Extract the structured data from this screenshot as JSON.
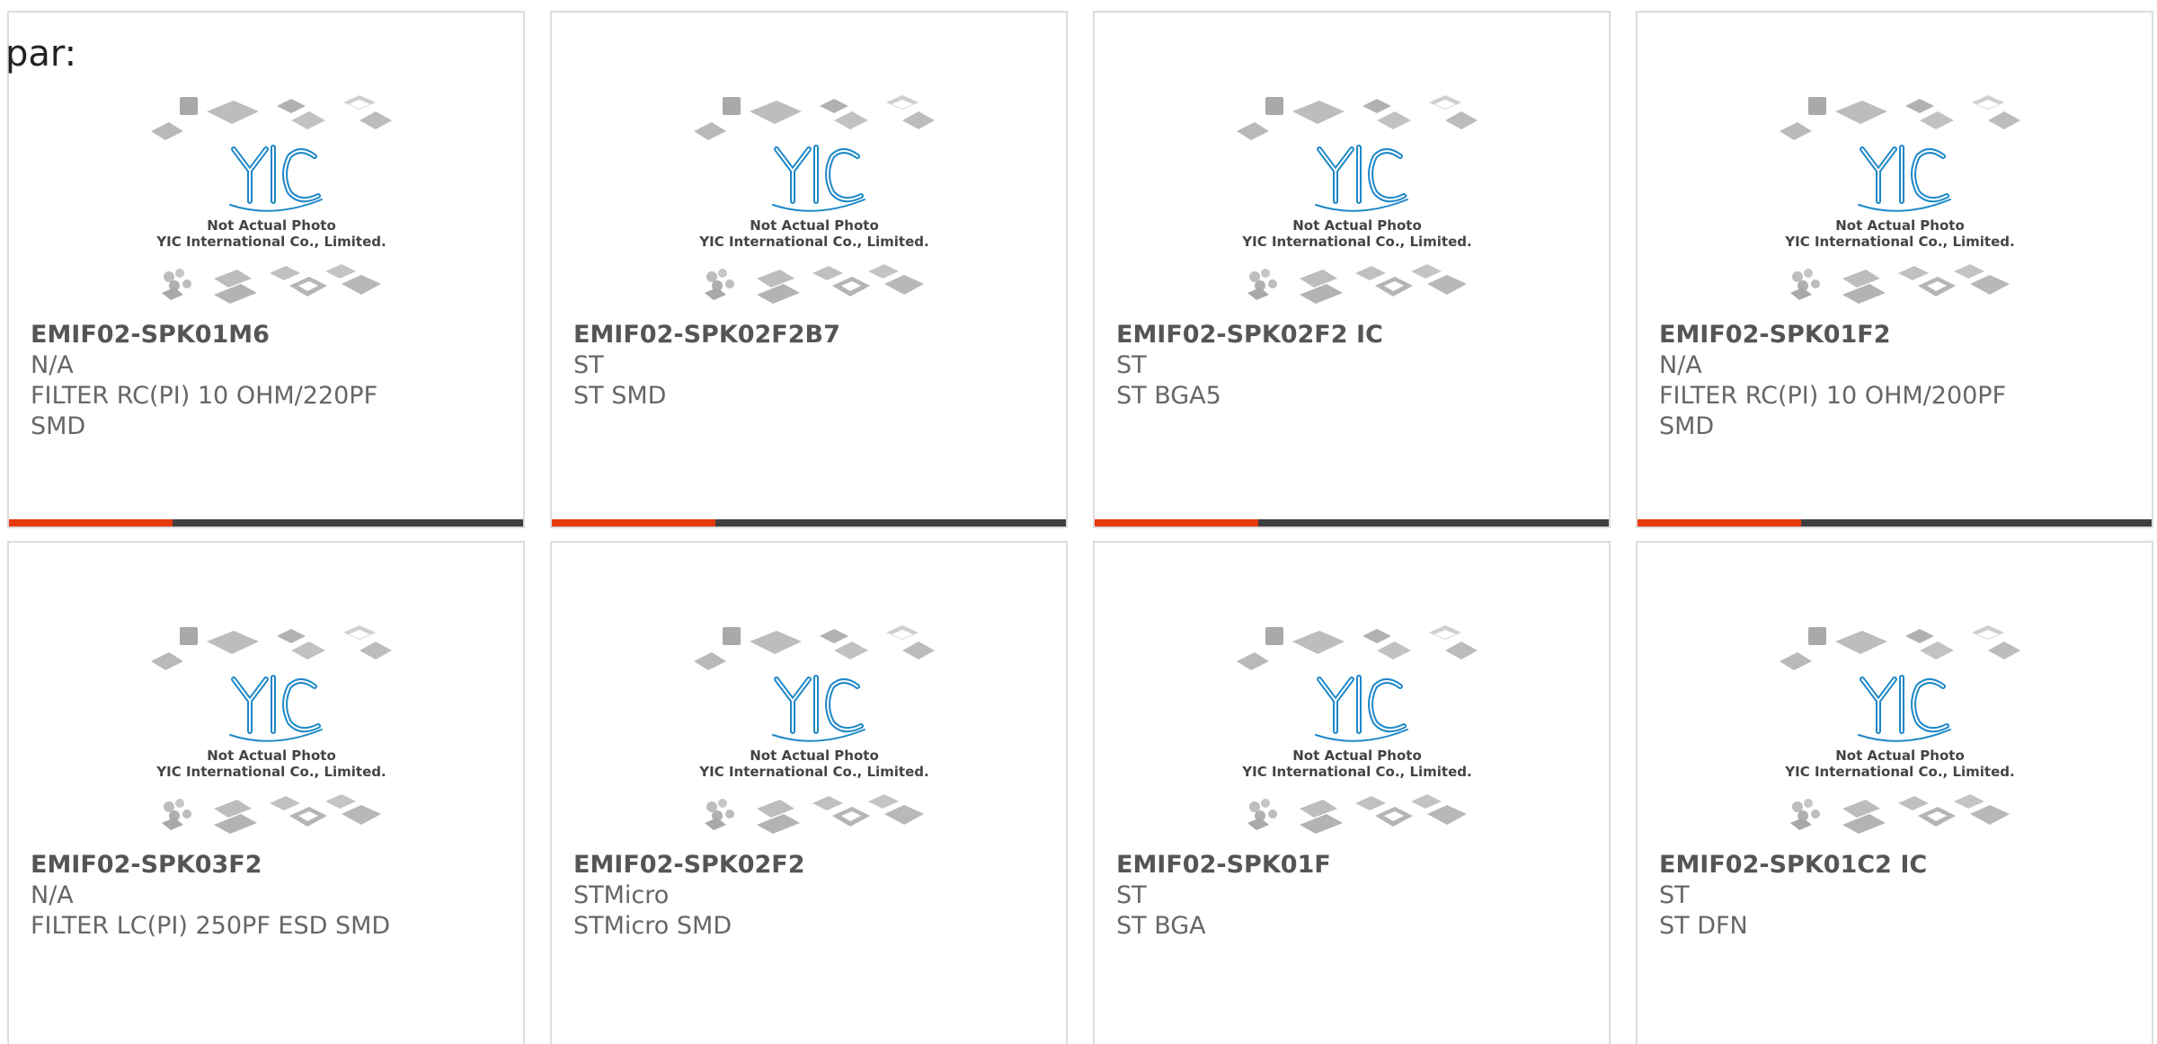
{
  "header": {
    "label": "par:"
  },
  "placeholder": {
    "caption_line1": "Not Actual Photo",
    "caption_line2": "YIC International Co., Limited.",
    "logo_text": "YIC"
  },
  "colors": {
    "accent": "#e8380d",
    "bar": "#3f3f3f",
    "logo_blue": "#1e88c8",
    "chip_gray": "#b4b4b4"
  },
  "products": [
    {
      "part": "EMIF02-SPK01M6",
      "brand": "N/A",
      "desc1": "FILTER RC(PI) 10 OHM/220PF",
      "desc2": "SMD"
    },
    {
      "part": "EMIF02-SPK02F2B7",
      "brand": "ST",
      "desc1": "ST SMD",
      "desc2": ""
    },
    {
      "part": "EMIF02-SPK02F2 IC",
      "brand": "ST",
      "desc1": "ST BGA5",
      "desc2": ""
    },
    {
      "part": "EMIF02-SPK01F2",
      "brand": "N/A",
      "desc1": "FILTER RC(PI) 10 OHM/200PF",
      "desc2": "SMD"
    },
    {
      "part": "EMIF02-SPK03F2",
      "brand": "N/A",
      "desc1": "FILTER LC(PI) 250PF ESD SMD",
      "desc2": ""
    },
    {
      "part": "EMIF02-SPK02F2",
      "brand": "STMicro",
      "desc1": "STMicro SMD",
      "desc2": ""
    },
    {
      "part": "EMIF02-SPK01F",
      "brand": "ST",
      "desc1": "ST BGA",
      "desc2": ""
    },
    {
      "part": "EMIF02-SPK01C2 IC",
      "brand": "ST",
      "desc1": "ST DFN",
      "desc2": ""
    }
  ]
}
